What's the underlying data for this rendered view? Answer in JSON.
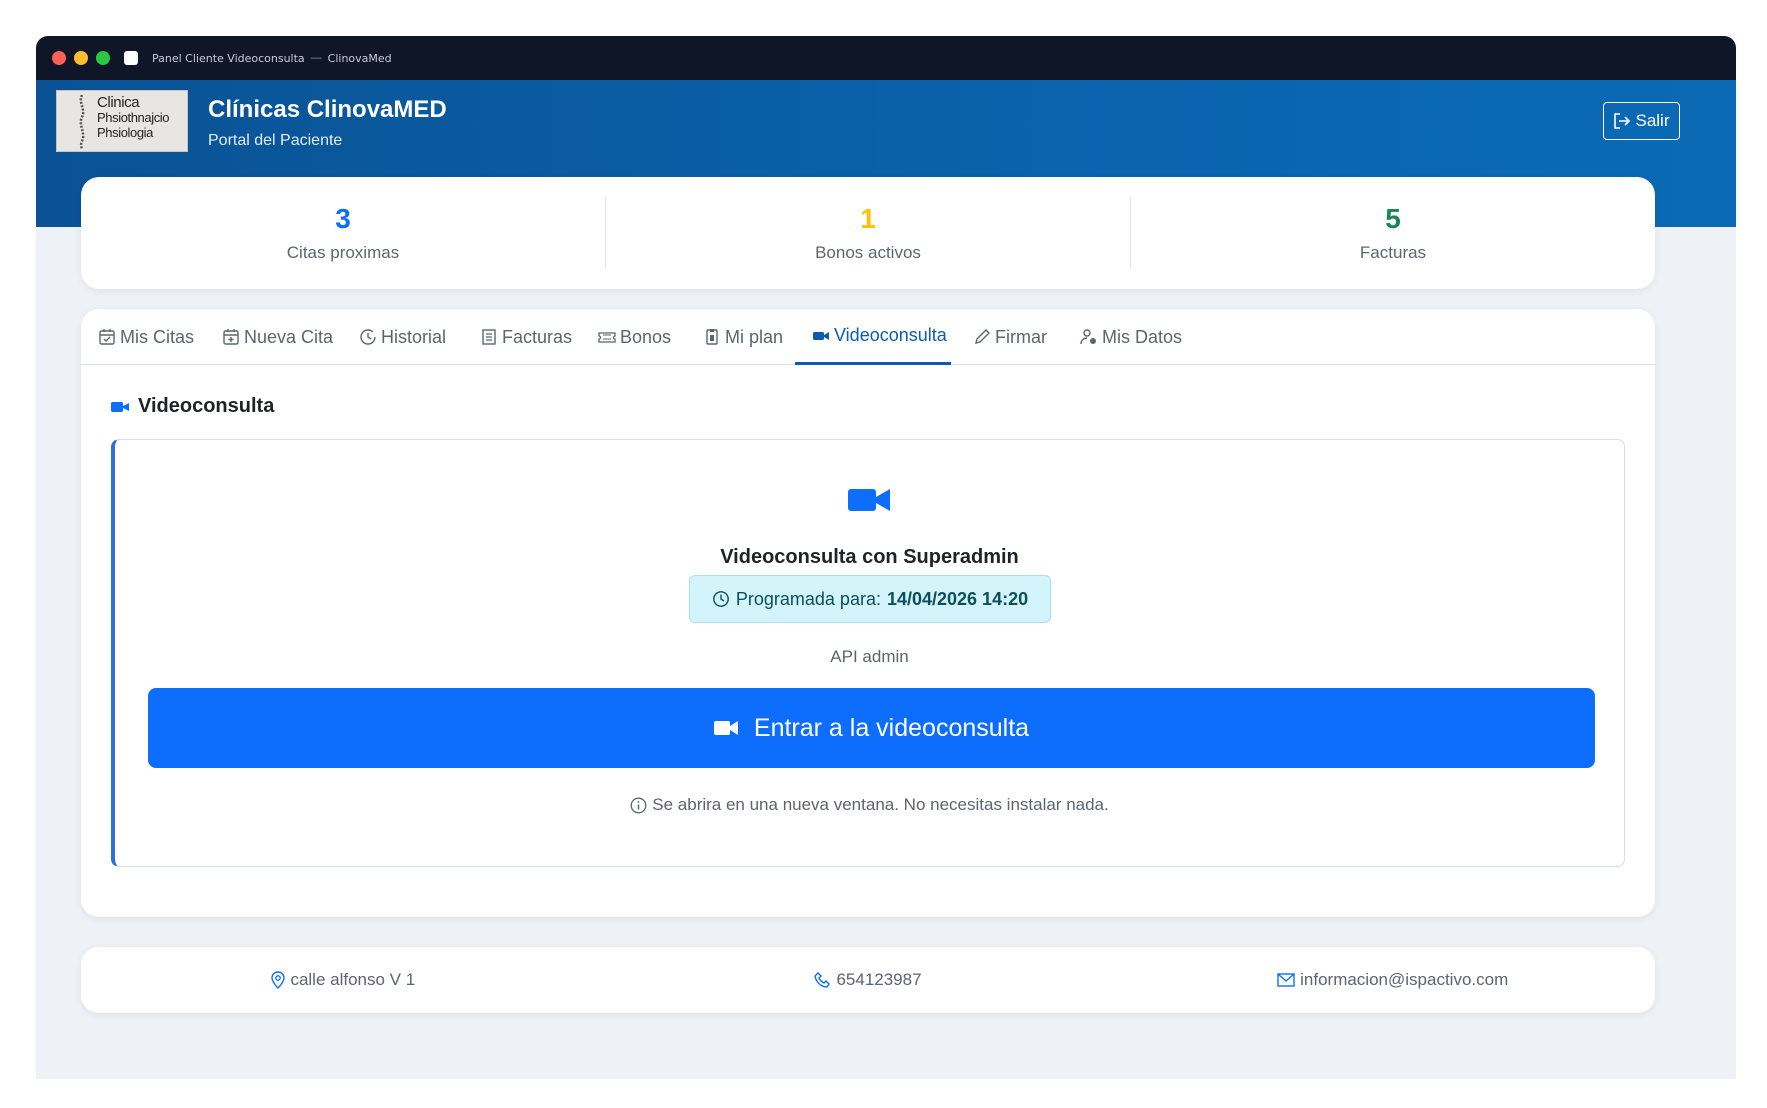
{
  "window": {
    "title": "Panel Cliente Videoconsulta",
    "separator": "—",
    "app": "ClinovaMed"
  },
  "logo": {
    "line1": "Clinica",
    "line2": "Phsiothnajcio",
    "line3": "Phsiologia"
  },
  "header": {
    "title": "Clínicas ClinovaMED",
    "subtitle": "Portal del Paciente",
    "exit_label": "Salir"
  },
  "stats": [
    {
      "value": "3",
      "label": "Citas proximas",
      "color": "#0d6efd"
    },
    {
      "value": "1",
      "label": "Bonos activos",
      "color": "#ffc107"
    },
    {
      "value": "5",
      "label": "Facturas",
      "color": "#198754"
    }
  ],
  "tabs": [
    {
      "label": "Mis Citas",
      "icon": "calendar-check-icon"
    },
    {
      "label": "Nueva Cita",
      "icon": "calendar-plus-icon"
    },
    {
      "label": "Historial",
      "icon": "clock-history-icon"
    },
    {
      "label": "Facturas",
      "icon": "receipt-icon"
    },
    {
      "label": "Bonos",
      "icon": "ticket-icon"
    },
    {
      "label": "Mi plan",
      "icon": "clipboard-pulse-icon"
    },
    {
      "label": "Videoconsulta",
      "icon": "camera-video-icon",
      "active": true
    },
    {
      "label": "Firmar",
      "icon": "pen-icon"
    },
    {
      "label": "Mis Datos",
      "icon": "person-gear-icon"
    }
  ],
  "section": {
    "title": "Videoconsulta"
  },
  "video": {
    "title": "Videoconsulta con Superadmin",
    "scheduled_label": "Programada para:",
    "scheduled_value": "14/04/2026 14:20",
    "subtitle": "API admin",
    "enter_label": "Entrar a la videoconsulta",
    "note": "Se abrira en una nueva ventana. No necesitas instalar nada."
  },
  "footer": {
    "address": "calle alfonso V 1",
    "phone": "654123987",
    "email": "informacion@ispactivo.com"
  },
  "colors": {
    "primary": "#0d6efd",
    "header": "#0a5ea8",
    "accent_border": "#2f6fdc"
  }
}
